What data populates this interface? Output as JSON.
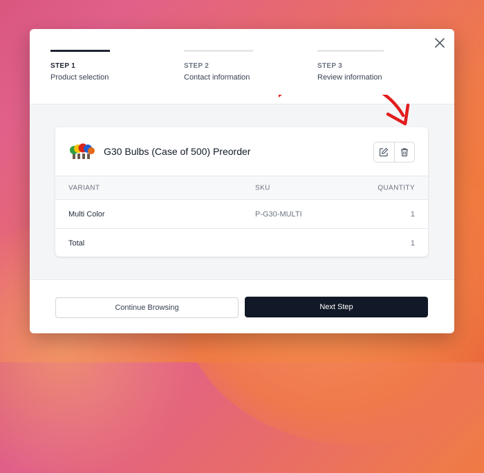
{
  "steps": [
    {
      "num": "STEP 1",
      "label": "Product selection"
    },
    {
      "num": "STEP 2",
      "label": "Contact information"
    },
    {
      "num": "STEP 3",
      "label": "Review information"
    }
  ],
  "product": {
    "title": "G30 Bulbs (Case of 500) Preorder"
  },
  "table": {
    "headers": {
      "variant": "VARIANT",
      "sku": "SKU",
      "quantity": "QUANTITY"
    },
    "rows": [
      {
        "variant": "Multi Color",
        "sku": "P-G30-MULTI",
        "quantity": "1"
      }
    ],
    "total": {
      "label": "Total",
      "quantity": "1"
    }
  },
  "buttons": {
    "continue": "Continue Browsing",
    "next": "Next Step"
  },
  "colors": {
    "primary": "#111827",
    "arrow": "#e11d1d",
    "active_step": "#1e2433"
  },
  "icons": [
    "close-icon",
    "edit-icon",
    "trash-icon",
    "curved-arrow"
  ]
}
